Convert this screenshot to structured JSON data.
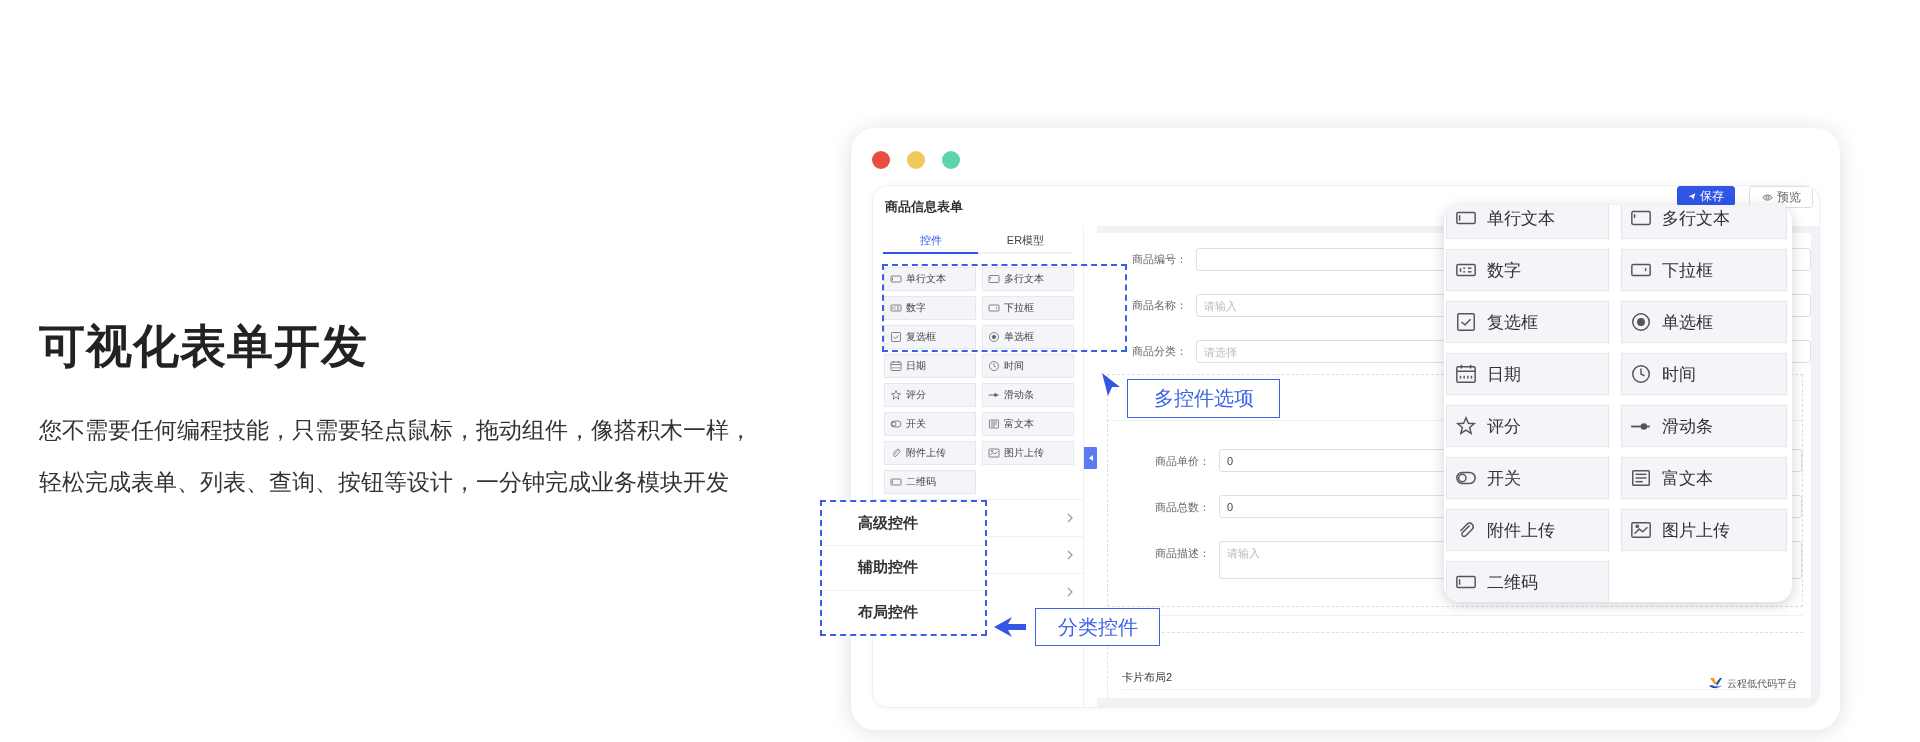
{
  "promo": {
    "heading": "可视化表单开发",
    "description": [
      "您不需要任何编程技能，只需要轻点鼠标，拖动组件，像搭积木一样，",
      "轻松完成表单、列表、查询、按钮等设计，一分钟完成业务模块开发"
    ]
  },
  "window": {
    "title": "商品信息表单",
    "buttons": [
      {
        "label": "保存",
        "kind": "primary"
      },
      {
        "label": "预览",
        "kind": "default"
      }
    ]
  },
  "sidebar": {
    "tabs": [
      {
        "label": "控件",
        "selected": true
      },
      {
        "label": "ER模型",
        "selected": false
      }
    ],
    "controls": [
      {
        "label": "单行文本",
        "kind": "text"
      },
      {
        "label": "多行文本",
        "kind": "textarea"
      },
      {
        "label": "数字",
        "kind": "number"
      },
      {
        "label": "下拉框",
        "kind": "select"
      },
      {
        "label": "复选框",
        "kind": "checkbox"
      },
      {
        "label": "单选框",
        "kind": "radio"
      },
      {
        "label": "日期",
        "kind": "date"
      },
      {
        "label": "时间",
        "kind": "time"
      },
      {
        "label": "评分",
        "kind": "rate"
      },
      {
        "label": "滑动条",
        "kind": "slider"
      },
      {
        "label": "开关",
        "kind": "switch"
      },
      {
        "label": "富文本",
        "kind": "richtext"
      },
      {
        "label": "附件上传",
        "kind": "upload"
      },
      {
        "label": "图片上传",
        "kind": "image"
      },
      {
        "label": "二维码",
        "kind": "qrcode"
      }
    ],
    "categories": [
      {
        "label": "高级控件"
      },
      {
        "label": "辅助控件"
      },
      {
        "label": "布局控件"
      }
    ]
  },
  "form": {
    "fields": [
      {
        "label": "商品编号：",
        "kind": "input"
      },
      {
        "label": "商品名称：",
        "kind": "input",
        "placeholder": "请输入"
      },
      {
        "label": "商品分类：",
        "kind": "input",
        "placeholder": "请选择"
      }
    ],
    "card_fields": [
      {
        "label": "商品单价：",
        "kind": "input",
        "value": "0"
      },
      {
        "label": "商品总数：",
        "kind": "input",
        "value": "0"
      },
      {
        "label": "商品描述：",
        "kind": "textarea",
        "placeholder": "请输入"
      }
    ],
    "section_title": "卡片布局2",
    "brand": "云程低代码平台"
  },
  "popup": {
    "controls": [
      {
        "label": "单行文本",
        "kind": "text"
      },
      {
        "label": "多行文本",
        "kind": "textarea"
      },
      {
        "label": "数字",
        "kind": "number"
      },
      {
        "label": "下拉框",
        "kind": "select"
      },
      {
        "label": "复选框",
        "kind": "checkbox"
      },
      {
        "label": "单选框",
        "kind": "radio"
      },
      {
        "label": "日期",
        "kind": "date"
      },
      {
        "label": "时间",
        "kind": "time"
      },
      {
        "label": "评分",
        "kind": "rate"
      },
      {
        "label": "滑动条",
        "kind": "slider"
      },
      {
        "label": "开关",
        "kind": "switch"
      },
      {
        "label": "富文本",
        "kind": "richtext"
      },
      {
        "label": "附件上传",
        "kind": "upload"
      },
      {
        "label": "图片上传",
        "kind": "image"
      },
      {
        "label": "二维码",
        "kind": "qrcode"
      }
    ]
  },
  "callouts": [
    {
      "label": "多控件选项"
    },
    {
      "label": "分类控件"
    }
  ]
}
